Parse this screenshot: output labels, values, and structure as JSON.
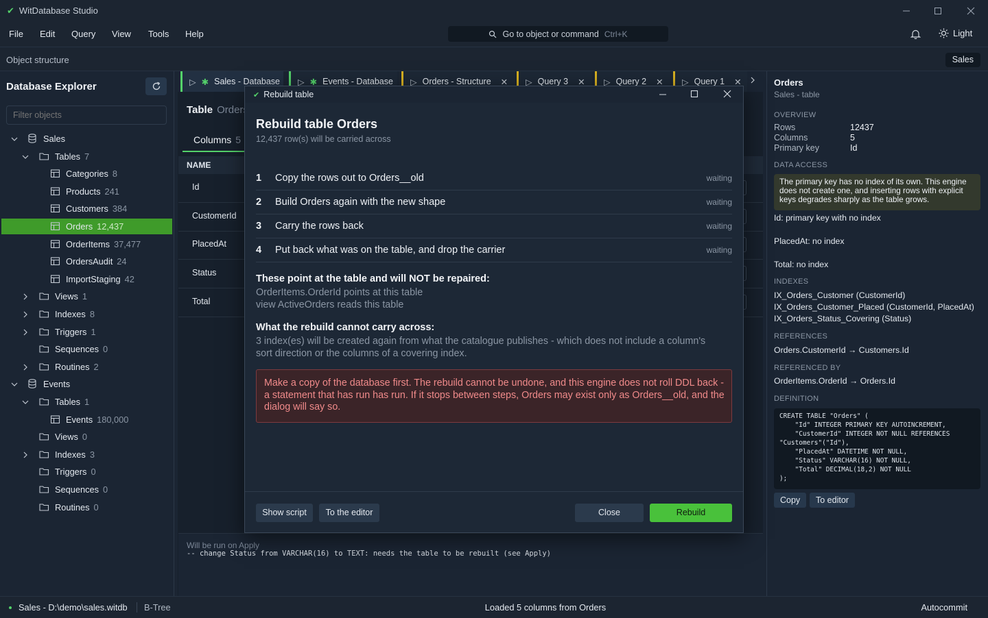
{
  "app": {
    "title": "WitDatabase Studio"
  },
  "menu": [
    "File",
    "Edit",
    "Query",
    "View",
    "Tools",
    "Help"
  ],
  "command_search": {
    "label": "Go to object or command",
    "shortcut": "Ctrl+K"
  },
  "theme": {
    "label": "Light"
  },
  "structure_bar": {
    "label": "Object structure",
    "database": "Sales"
  },
  "explorer": {
    "title": "Database Explorer",
    "filter_placeholder": "Filter objects",
    "items": [
      {
        "label": "Sales",
        "count": ""
      },
      {
        "label": "Tables",
        "count": "7"
      },
      {
        "label": "Categories",
        "count": "8"
      },
      {
        "label": "Products",
        "count": "241"
      },
      {
        "label": "Customers",
        "count": "384"
      },
      {
        "label": "Orders",
        "count": "12,437"
      },
      {
        "label": "OrderItems",
        "count": "37,477"
      },
      {
        "label": "OrdersAudit",
        "count": "24"
      },
      {
        "label": "ImportStaging",
        "count": "42"
      },
      {
        "label": "Views",
        "count": "1"
      },
      {
        "label": "Indexes",
        "count": "8"
      },
      {
        "label": "Triggers",
        "count": "1"
      },
      {
        "label": "Sequences",
        "count": "0"
      },
      {
        "label": "Routines",
        "count": "2"
      },
      {
        "label": "Events",
        "count": ""
      },
      {
        "label": "Tables",
        "count": "1"
      },
      {
        "label": "Events",
        "count": "180,000"
      },
      {
        "label": "Views",
        "count": "0"
      },
      {
        "label": "Indexes",
        "count": "3"
      },
      {
        "label": "Triggers",
        "count": "0"
      },
      {
        "label": "Sequences",
        "count": "0"
      },
      {
        "label": "Routines",
        "count": "0"
      }
    ]
  },
  "tabs": [
    {
      "label": "Sales - Database"
    },
    {
      "label": "Events - Database"
    },
    {
      "label": "Orders - Structure"
    },
    {
      "label": "Query 3"
    },
    {
      "label": "Query 2"
    },
    {
      "label": "Query 1"
    }
  ],
  "editor": {
    "heading": "Table",
    "heading_name": "Orders",
    "columns_tab": "Columns",
    "columns_count": "5",
    "name_header": "NAME",
    "columns": [
      "Id",
      "CustomerId",
      "PlacedAt",
      "Status",
      "Total"
    ],
    "apply_label": "Will be run on Apply",
    "apply_sql": "-- change Status from VARCHAR(16) to TEXT: needs the table to be rebuilt (see Apply)"
  },
  "modal": {
    "window_title": "Rebuild table",
    "heading": "Rebuild table Orders",
    "subtitle": "12,437 row(s) will be carried across",
    "steps": [
      {
        "num": "1",
        "text": "Copy the rows out to Orders__old",
        "state": "waiting"
      },
      {
        "num": "2",
        "text": "Build Orders again with the new shape",
        "state": "waiting"
      },
      {
        "num": "3",
        "text": "Carry the rows back",
        "state": "waiting"
      },
      {
        "num": "4",
        "text": "Put back what was on the table, and drop the carrier",
        "state": "waiting"
      }
    ],
    "not_repaired_title": "These point at the table and will NOT be repaired:",
    "not_repaired": [
      "OrderItems.OrderId points at this table",
      "view ActiveOrders reads this table"
    ],
    "cannot_carry_title": "What the rebuild cannot carry across:",
    "cannot_carry_text": "3 index(es) will be created again from what the catalogue publishes - which does not include a column's sort direction or the columns of a covering index.",
    "danger_text": "Make a copy of the database first. The rebuild cannot be undone, and this engine does not roll DDL back - a statement that has run has run. If it stops between steps, Orders may exist only as Orders__old, and the dialog will say so.",
    "buttons": {
      "show_script": "Show script",
      "to_editor": "To the editor",
      "close": "Close",
      "rebuild": "Rebuild"
    }
  },
  "details": {
    "title": "Orders",
    "subtitle": "Sales - table",
    "overview_label": "OVERVIEW",
    "overview": [
      {
        "key": "Rows",
        "value": "12437"
      },
      {
        "key": "Columns",
        "value": "5"
      },
      {
        "key": "Primary key",
        "value": "Id"
      }
    ],
    "data_access_label": "DATA ACCESS",
    "warning": "The primary key has no index of its own. This engine does not create one, and inserting rows with explicit keys degrades sharply as the table grows.",
    "access_notes": [
      "Id: primary key with no index",
      "PlacedAt: no index",
      "Total: no index"
    ],
    "indexes_label": "INDEXES",
    "indexes": [
      "IX_Orders_Customer (CustomerId)",
      "IX_Orders_Customer_Placed (CustomerId, PlacedAt)",
      "IX_Orders_Status_Covering (Status)"
    ],
    "references_label": "REFERENCES",
    "references": "Orders.CustomerId → Customers.Id",
    "referenced_by_label": "REFERENCED BY",
    "referenced_by": "OrderItems.OrderId → Orders.Id",
    "definition_label": "DEFINITION",
    "definition": "CREATE TABLE \"Orders\" (\n    \"Id\" INTEGER PRIMARY KEY AUTOINCREMENT,\n    \"CustomerId\" INTEGER NOT NULL REFERENCES\n\"Customers\"(\"Id\"),\n    \"PlacedAt\" DATETIME NOT NULL,\n    \"Status\" VARCHAR(16) NOT NULL,\n    \"Total\" DECIMAL(18,2) NOT NULL\n);",
    "copy_label": "Copy",
    "to_editor_label": "To editor"
  },
  "status": {
    "path": "Sales - D:\\demo\\sales.witdb",
    "engine": "B-Tree",
    "message": "Loaded 5 columns from Orders",
    "mode": "Autocommit"
  },
  "colors": {
    "accent": "#54d26a",
    "selected": "#3f9b2a",
    "danger": "#f08a8a",
    "tab_marker": "#d7b021"
  }
}
